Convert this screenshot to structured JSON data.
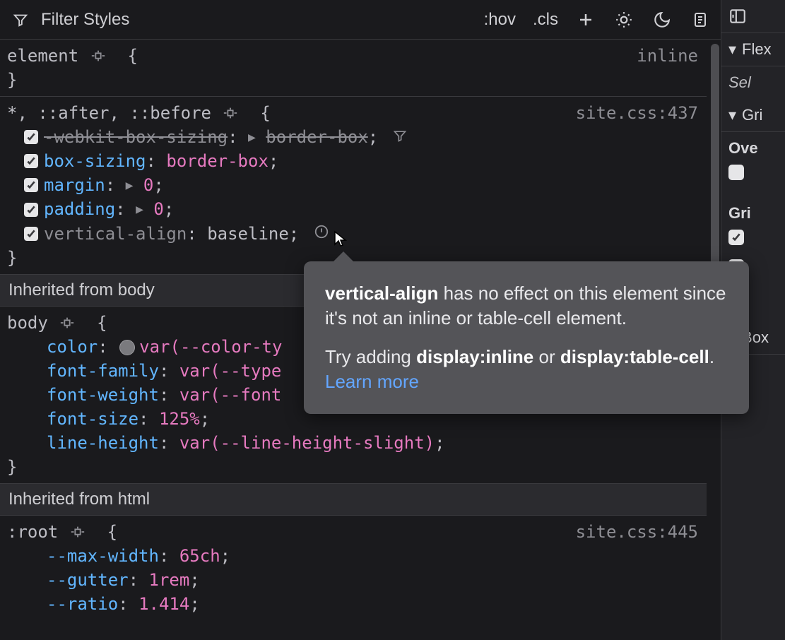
{
  "toolbar": {
    "filter_placeholder": "Filter Styles",
    "hov_label": ":hov",
    "cls_label": ".cls"
  },
  "rules": [
    {
      "id": "element-rule",
      "selector": "element",
      "has_highlight_icon": true,
      "source": "inline",
      "close": "}",
      "declarations": []
    },
    {
      "id": "universal-rule",
      "selector": "*, ::after, ::before",
      "has_highlight_icon": true,
      "source": "site.css:437",
      "close": "}",
      "declarations": [
        {
          "prop": "-webkit-box-sizing",
          "value": "border-box",
          "overridden": true,
          "expand": true,
          "filter_icon": true
        },
        {
          "prop": "box-sizing",
          "value": "border-box"
        },
        {
          "prop": "margin",
          "value": "0",
          "expand": true
        },
        {
          "prop": "padding",
          "value": "0",
          "expand": true
        },
        {
          "prop": "vertical-align",
          "value": "baseline",
          "warn": true
        }
      ]
    }
  ],
  "inherit_body_label": "Inherited from body",
  "body_rule": {
    "selector": "body",
    "has_highlight_icon": true,
    "close": "}",
    "declarations": [
      {
        "prop": "color",
        "value_trunc": "var(--color-ty",
        "swatch": true
      },
      {
        "prop": "font-family",
        "value_trunc": "var(--type"
      },
      {
        "prop": "font-weight",
        "value_trunc": "var(--font"
      },
      {
        "prop": "font-size",
        "value": "125%"
      },
      {
        "prop": "line-height",
        "value": "var(--line-height-slight)"
      }
    ]
  },
  "inherit_html_label": "Inherited from html",
  "root_rule": {
    "selector": ":root",
    "has_highlight_icon": true,
    "source": "site.css:445",
    "declarations": [
      {
        "prop": "--max-width",
        "value": "65ch"
      },
      {
        "prop": "--gutter",
        "value": "1rem"
      },
      {
        "prop": "--ratio",
        "value": "1.414"
      }
    ]
  },
  "tooltip": {
    "bold1": "vertical-align",
    "text1": " has no effect on this element since it's not an inline or table-cell element.",
    "text2a": "Try adding ",
    "bold2": "display:inline",
    "text2b": " or ",
    "bold3": "display:table-cell",
    "text2c": ". ",
    "learn_more": "Learn more"
  },
  "side": {
    "flex_label": "Flex",
    "select_hint": "Sel",
    "grid_label": "Gri",
    "overlay_label": "Ove",
    "grid_sub_label": "Gri",
    "box_label": "Box",
    "checks": [
      true,
      true,
      false
    ]
  }
}
